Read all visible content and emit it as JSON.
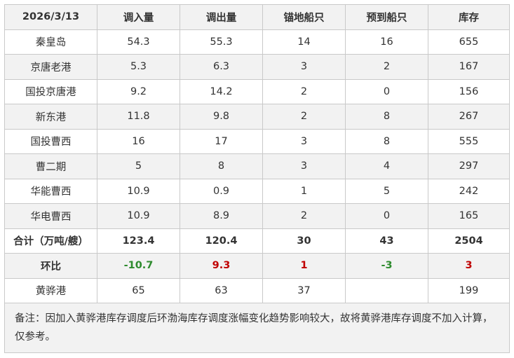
{
  "table": {
    "headers": [
      "2026/3/13",
      "调入量",
      "调出量",
      "锚地船只",
      "预到船只",
      "库存"
    ],
    "rows": [
      [
        "秦皇岛",
        "54.3",
        "55.3",
        "14",
        "16",
        "655"
      ],
      [
        "京唐老港",
        "5.3",
        "6.3",
        "3",
        "2",
        "167"
      ],
      [
        "国投京唐港",
        "9.2",
        "14.2",
        "2",
        "0",
        "156"
      ],
      [
        "新东港",
        "11.8",
        "9.8",
        "2",
        "8",
        "267"
      ],
      [
        "国投曹西",
        "16",
        "17",
        "3",
        "8",
        "555"
      ],
      [
        "曹二期",
        "5",
        "8",
        "3",
        "4",
        "297"
      ],
      [
        "华能曹西",
        "10.9",
        "0.9",
        "1",
        "5",
        "242"
      ],
      [
        "华电曹西",
        "10.9",
        "8.9",
        "2",
        "0",
        "165"
      ]
    ],
    "total": [
      "合计（万吨/艘）",
      "123.4",
      "120.4",
      "30",
      "43",
      "2504"
    ],
    "ratio": {
      "label": "环比",
      "values": [
        "-10.7",
        "9.3",
        "1",
        "-3",
        "3"
      ]
    },
    "huanghua": [
      "黄骅港",
      "65",
      "63",
      "37",
      "",
      "199"
    ],
    "note": "备注：因加入黄骅港库存调度后环渤海库存调度涨幅变化趋势影响较大，故将黄骅港库存调度不加入计算，仅参考。"
  },
  "colors": {
    "increase": "#c00000",
    "decrease": "#2e8b2e",
    "header_bg": "#f2f2f2",
    "border": "#c9c9c9"
  }
}
